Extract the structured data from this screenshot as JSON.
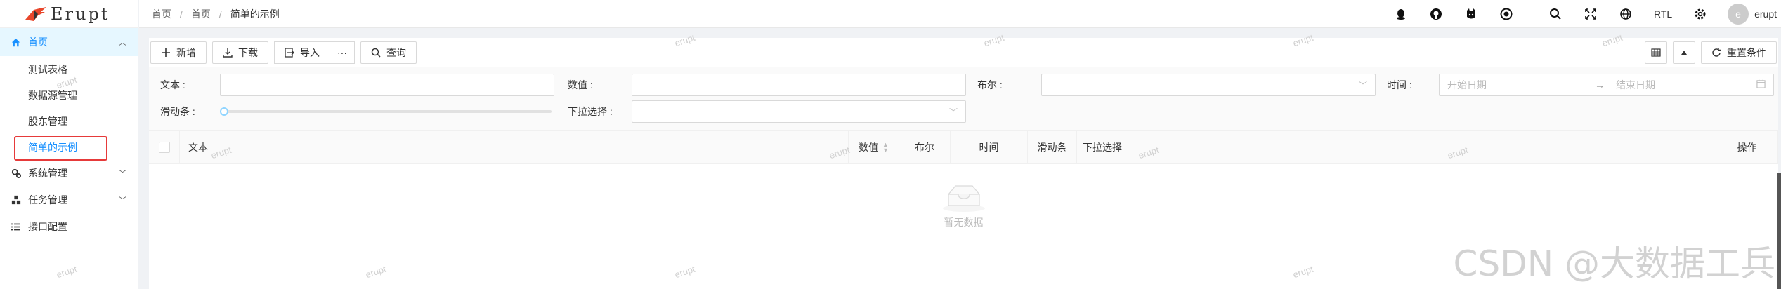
{
  "app": {
    "logo_text": "Erupt"
  },
  "breadcrumb": [
    "首页",
    "首页",
    "简单的示例"
  ],
  "sidebar": {
    "root": "首页",
    "sub_items": [
      "测试表格",
      "数据源管理",
      "股东管理",
      "简单的示例"
    ],
    "groups": [
      "系统管理",
      "任务管理",
      "接口配置"
    ]
  },
  "header": {
    "rtl": "RTL",
    "avatar_letter": "e",
    "username": "erupt"
  },
  "toolbar": {
    "add": "新增",
    "download": "下载",
    "import": "导入",
    "more": "···",
    "query": "查询",
    "reset": "重置条件"
  },
  "search": {
    "text_label": "文本 :",
    "number_label": "数值 :",
    "bool_label": "布尔 :",
    "time_label": "时间 :",
    "start_placeholder": "开始日期",
    "end_placeholder": "结束日期",
    "slider_label": "滑动条 :",
    "select_label": "下拉选择 :"
  },
  "table": {
    "columns": [
      "文本",
      "数值",
      "布尔",
      "时间",
      "滑动条",
      "下拉选择",
      "操作"
    ],
    "empty_text": "暂无数据"
  },
  "watermark": "erupt",
  "csdn_mark": "CSDN @大数据工兵",
  "colors": {
    "primary": "#1890ff",
    "active_bg": "#e6f7ff",
    "highlight_border": "#e63a3a"
  }
}
